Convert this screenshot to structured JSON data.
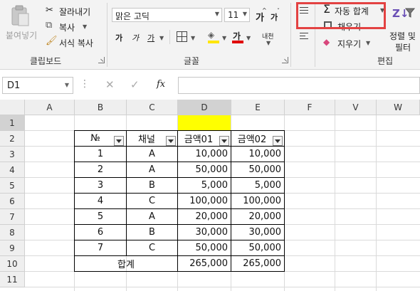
{
  "ribbon": {
    "clipboard": {
      "paste_label": "붙여넣기",
      "cut_label": "잘라내기",
      "copy_label": "복사",
      "format_painter_label": "서식 복사",
      "group_label": "클립보드"
    },
    "font": {
      "font_name": "맑은 고딕",
      "font_size": "11",
      "grow_label": "가",
      "shrink_label": "가",
      "bold_label": "가",
      "italic_label": "가",
      "underline_label": "가",
      "font_color_label": "가",
      "phonetic_label": "내천",
      "group_label": "글꼴"
    },
    "editing": {
      "autosum_label": "자동 합계",
      "fill_label": "채우기",
      "clear_label": "지우기",
      "sort_label_1": "정렬 및",
      "sort_label_2": "필터",
      "group_label": "편집"
    }
  },
  "formula_bar": {
    "name_box": "D1",
    "fx_label": "fx",
    "formula": ""
  },
  "grid": {
    "columns": [
      "A",
      "B",
      "C",
      "D",
      "E",
      "F",
      "V",
      "W"
    ],
    "rows": [
      "1",
      "2",
      "3",
      "4",
      "5",
      "6",
      "7",
      "8",
      "9",
      "10",
      "11"
    ],
    "selected_cell": "D1",
    "table": {
      "headers": [
        "№",
        "채널",
        "금액01",
        "금액02"
      ],
      "rows": [
        [
          "1",
          "A",
          "10,000",
          "10,000"
        ],
        [
          "2",
          "A",
          "50,000",
          "50,000"
        ],
        [
          "3",
          "B",
          "5,000",
          "5,000"
        ],
        [
          "4",
          "C",
          "100,000",
          "100,000"
        ],
        [
          "5",
          "A",
          "20,000",
          "20,000"
        ],
        [
          "6",
          "B",
          "30,000",
          "30,000"
        ],
        [
          "7",
          "C",
          "50,000",
          "50,000"
        ]
      ],
      "total_label": "합계",
      "totals": [
        "265,000",
        "265,000"
      ]
    }
  },
  "colors": {
    "highlight_border": "#e34242",
    "selected_cell_fill": "#ffff00",
    "font_color_bar": "#e00000",
    "fill_color_bar": "#ffe600"
  }
}
